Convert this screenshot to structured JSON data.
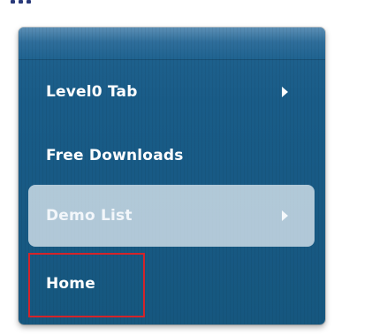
{
  "menu": {
    "items": [
      {
        "label": "Level0 Tab",
        "has_submenu": true,
        "state": "normal"
      },
      {
        "label": "Free Downloads",
        "has_submenu": false,
        "state": "normal"
      },
      {
        "label": "Demo List",
        "has_submenu": true,
        "state": "hover"
      },
      {
        "label": "Home",
        "has_submenu": false,
        "state": "highlighted"
      }
    ],
    "arrow_icon": "chevron-right-icon"
  },
  "colors": {
    "menu_background": "#195c88",
    "menu_header": "#2f6e9b",
    "hover_item": "#dce8f0",
    "text": "#ffffff",
    "highlight_border": "#d4242a"
  }
}
